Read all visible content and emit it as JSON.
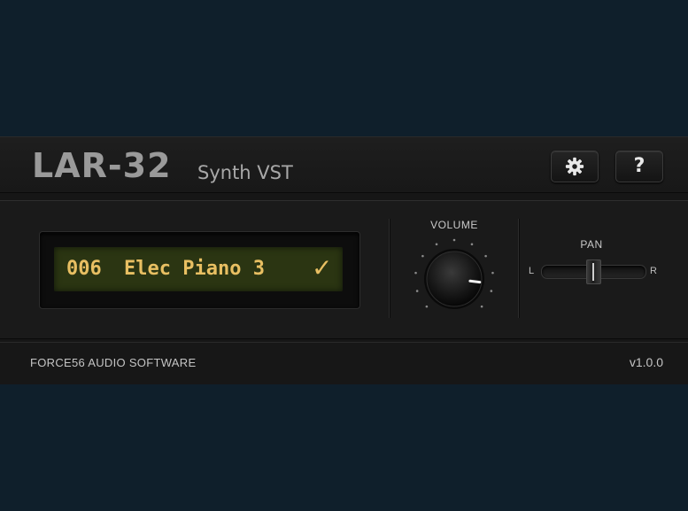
{
  "header": {
    "product_name": "LAR-32",
    "product_subtitle": "Synth VST",
    "settings_icon": "gear-icon",
    "help_label": "?"
  },
  "display": {
    "preset_number": "006",
    "preset_name": "Elec Piano 3",
    "status_glyph": "✓"
  },
  "volume": {
    "label": "VOLUME",
    "level": 0.86
  },
  "pan": {
    "label": "PAN",
    "left_label": "L",
    "right_label": "R",
    "value": 0.5
  },
  "footer": {
    "company": "FORCE56 AUDIO SOFTWARE",
    "version": "v1.0.0"
  },
  "colors": {
    "background": "#0f1f2b",
    "lcd_background": "#2b3512",
    "lcd_text": "#e8bf62",
    "panel": "#161616"
  }
}
